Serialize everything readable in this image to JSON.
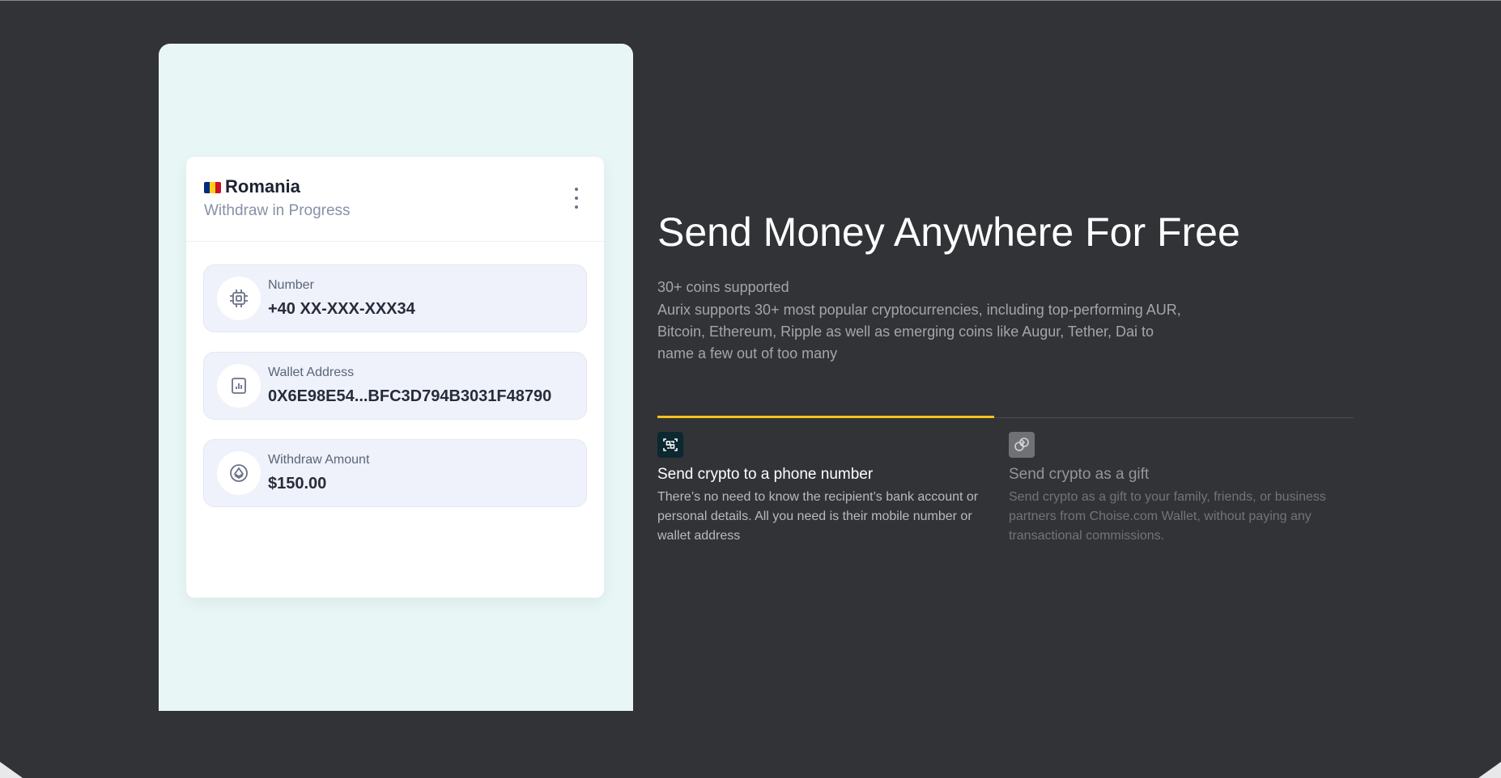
{
  "card": {
    "country": "Romania",
    "status": "Withdraw in Progress",
    "flag_colors": [
      "#002b7f",
      "#fcd116",
      "#ce1126"
    ],
    "rows": [
      {
        "icon": "chip-icon",
        "label": "Number",
        "value": "+40 XX-XXX-XXX34"
      },
      {
        "icon": "chart-icon",
        "label": "Wallet Address",
        "value": "0X6E98E54...BFC3D794B3031F48790"
      },
      {
        "icon": "coin-icon",
        "label": "Withdraw Amount",
        "value": "$150.00"
      }
    ]
  },
  "hero": {
    "title": "Send Money Anywhere For Free",
    "subtitle": "30+ coins supported",
    "description": "Aurix supports 30+ most popular cryptocurrencies, including top-performing AUR, Bitcoin, Ethereum, Ripple as well as emerging coins like Augur, Tether, Dai to name a few out of too many"
  },
  "features": [
    {
      "icon": "phone-scan-icon",
      "title": "Send crypto to a phone number",
      "text": "There’s no need to know the recipient’s bank account or personal details. All you need is their mobile number or wallet address",
      "active": true
    },
    {
      "icon": "gift-icon",
      "title": "Send crypto as a gift",
      "text": "Send crypto as a gift to your family, friends, or business partners from Choise.com Wallet, without paying any transactional commissions.",
      "active": false
    }
  ],
  "colors": {
    "background": "#323337",
    "accent": "#f4c21c",
    "panel": "#e8f6f6"
  }
}
